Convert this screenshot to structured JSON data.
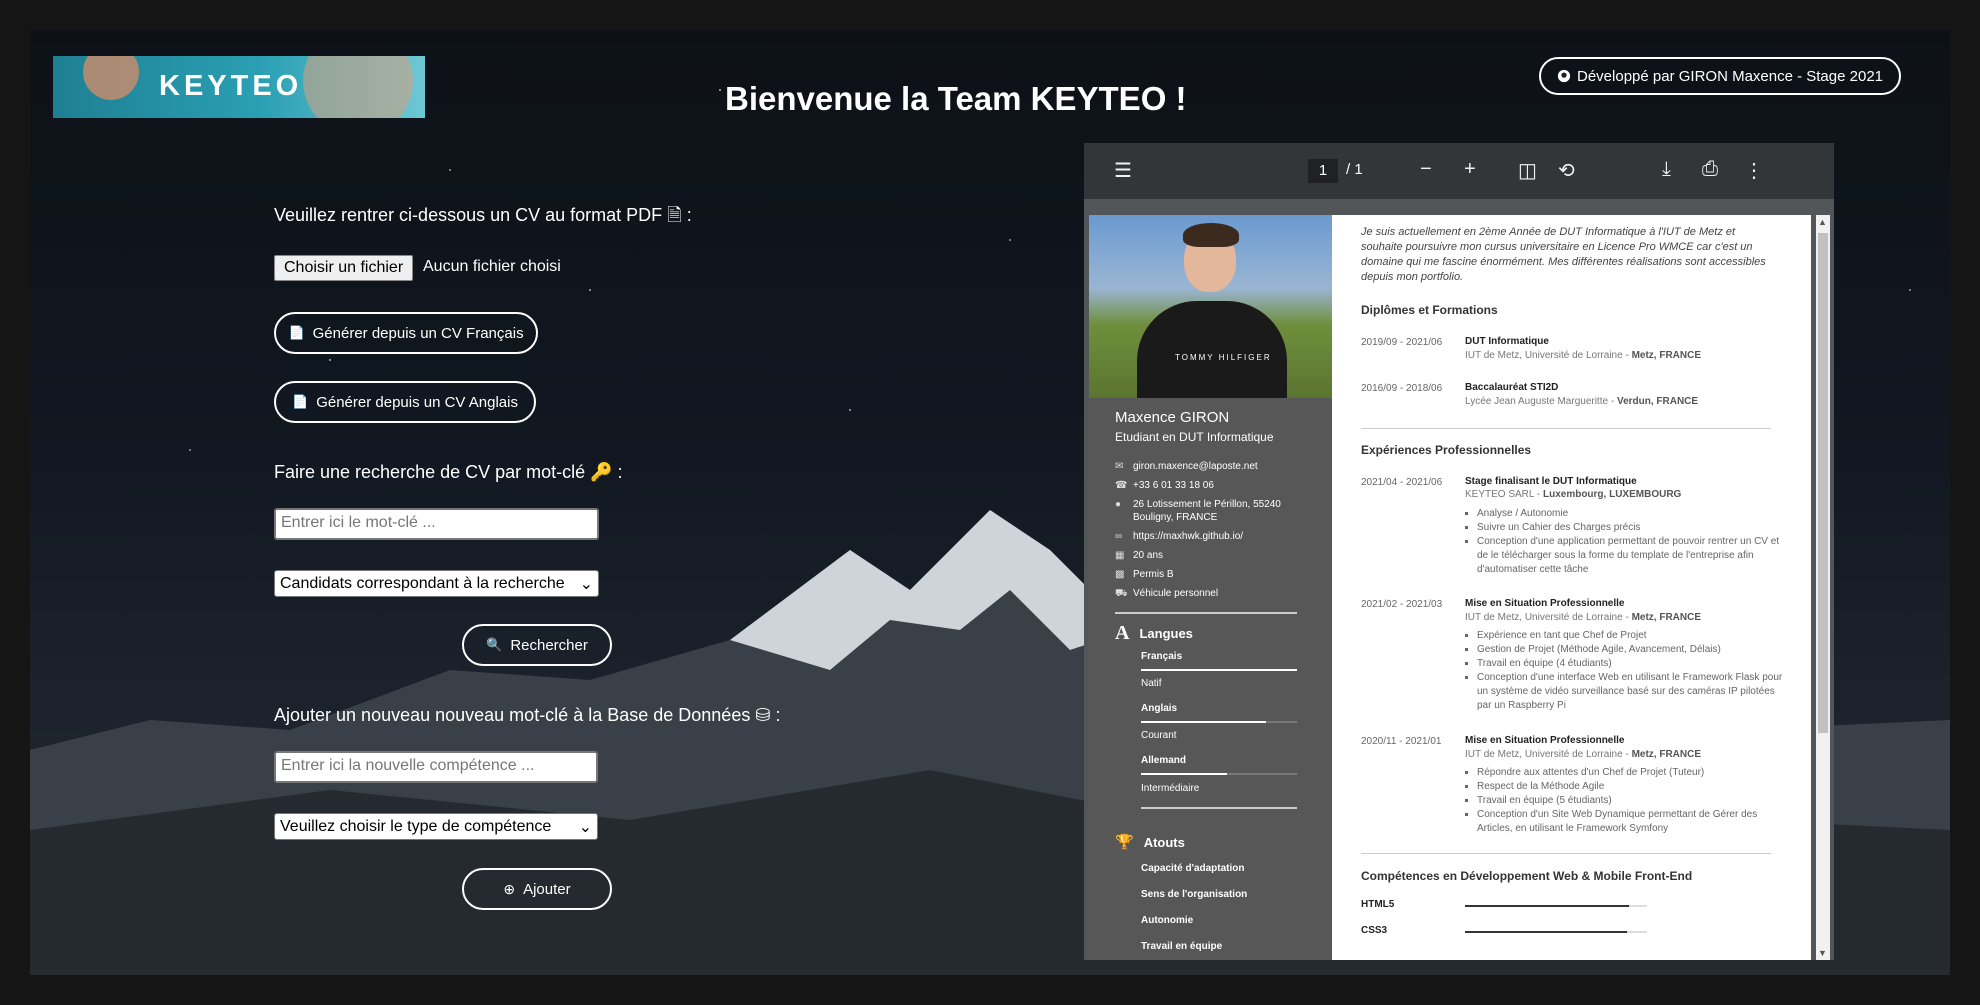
{
  "header": {
    "logo_text": "KEYTEO",
    "title": "Bienvenue la Team KEYTEO !",
    "credit": "Développé par GIRON Maxence - Stage 2021"
  },
  "form": {
    "upload_label": "Veuillez rentrer ci-dessous un CV au format PDF",
    "upload_suffix": ":",
    "file_button": "Choisir un fichier",
    "file_status": "Aucun fichier choisi",
    "gen_fr": "Générer depuis un CV Français",
    "gen_en": "Générer depuis un CV Anglais",
    "search_label": "Faire une recherche de CV par mot-clé",
    "search_suffix": ":",
    "search_placeholder": "Entrer ici le mot-clé ...",
    "search_select": "Candidats correspondant à la recherche",
    "search_button": "Rechercher",
    "add_label": "Ajouter un nouveau nouveau mot-clé à la Base de Données",
    "add_suffix": ":",
    "add_placeholder": "Entrer ici la nouvelle compétence ...",
    "add_select": "Veuillez choisir le type de compétence",
    "add_button": "Ajouter"
  },
  "viewer": {
    "page_current": "1",
    "page_total": "/ 1"
  },
  "cv": {
    "photo_shirt_text": "TOMMY HILFIGER",
    "name": "Maxence GIRON",
    "job": "Etudiant en DUT Informatique",
    "contact": [
      "giron.maxence@laposte.net",
      "+33 6 01 33 18 06",
      "26 Lotissement le Périllon, 55240",
      "Bouligny, FRANCE",
      "https://maxhwk.github.io/",
      "20 ans",
      "Permis B",
      "Véhicule personnel"
    ],
    "langues_title": "Langues",
    "langues": [
      {
        "name": "Français",
        "level": "Natif",
        "fill": 1.0
      },
      {
        "name": "Anglais",
        "level": "Courant",
        "fill": 0.8
      },
      {
        "name": "Allemand",
        "level": "Intermédiaire",
        "fill": 0.55
      }
    ],
    "atouts_title": "Atouts",
    "atouts": [
      "Capacité d'adaptation",
      "Sens de l'organisation",
      "Autonomie",
      "Travail en équipe"
    ],
    "intro": "Je suis actuellement en 2ème Année de DUT Informatique à l'IUT de Metz et souhaite poursuivre mon cursus universitaire en Licence Pro WMCE car c'est un domaine qui me fascine énormément. Mes différentes réalisations sont accessibles depuis mon portfolio.",
    "diplomes_title": "Diplômes et Formations",
    "diplomes": [
      {
        "date": "2019/09 - 2021/06",
        "title": "DUT Informatique",
        "place": "IUT de Metz, Université de Lorraine - ",
        "city": "Metz, FRANCE"
      },
      {
        "date": "2016/09 - 2018/06",
        "title": "Baccalauréat STI2D",
        "place": "Lycée Jean Auguste Margueritte - ",
        "city": "Verdun, FRANCE"
      }
    ],
    "exp_title": "Expériences Professionnelles",
    "exp": [
      {
        "date": "2021/04 - 2021/06",
        "title": "Stage finalisant le DUT Informatique",
        "place": "KEYTEO SARL - ",
        "city": "Luxembourg, LUXEMBOURG",
        "items": [
          "Analyse / Autonomie",
          "Suivre un Cahier des Charges précis",
          "Conception d'une application permettant de pouvoir rentrer un CV et de le télécharger sous la forme du template de l'entreprise afin d'automatiser cette tâche"
        ]
      },
      {
        "date": "2021/02 - 2021/03",
        "title": "Mise en Situation Professionnelle",
        "place": "IUT de Metz, Université de Lorraine - ",
        "city": "Metz, FRANCE",
        "items": [
          "Expérience en tant que Chef de Projet",
          "Gestion de Projet (Méthode Agile, Avancement, Délais)",
          "Travail en équipe (4 étudiants)",
          "Conception d'une interface Web en utilisant le Framework Flask pour un système de vidéo surveillance basé sur des caméras IP pilotées par un Raspberry Pi"
        ]
      },
      {
        "date": "2020/11 - 2021/01",
        "title": "Mise en Situation Professionnelle",
        "place": "IUT de Metz, Université de Lorraine - ",
        "city": "Metz, FRANCE",
        "items": [
          "Répondre aux attentes d'un Chef de Projet (Tuteur)",
          "Respect de la Méthode Agile",
          "Travail en équipe (5 étudiants)",
          "Conception d'un Site Web Dynamique permettant de Gérer des Articles, en utilisant le Framework Symfony"
        ]
      }
    ],
    "skills_title": "Compétences en Développement Web & Mobile Front-End",
    "skills": [
      {
        "name": "HTML5",
        "fill": 0.9
      },
      {
        "name": "CSS3",
        "fill": 0.89
      }
    ]
  },
  "icons": {
    "pdf": "file-pdf-icon",
    "key": "key-icon",
    "database": "database-icon",
    "github": "github-icon"
  }
}
